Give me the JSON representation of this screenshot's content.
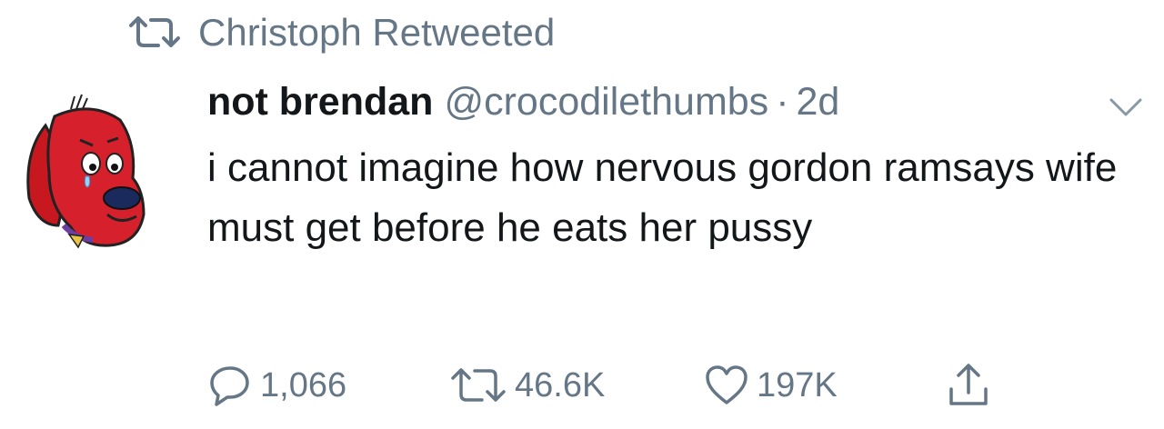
{
  "retweet_banner": {
    "text": "Christoph Retweeted",
    "icon": "retweet-icon"
  },
  "tweet": {
    "display_name": "not brendan",
    "handle": "@crocodilethumbs",
    "separator": "·",
    "time": "2d",
    "text": "i cannot imagine how nervous gordon ramsays wife must get before he eats her pussy",
    "avatar_icon": "red-dog-avatar"
  },
  "actions": {
    "reply_count": "1,066",
    "retweet_count": "46.6K",
    "like_count": "197K",
    "share_icon": "share-icon"
  },
  "colors": {
    "text": "#14171a",
    "muted": "#657786",
    "avatar_red": "#d6202c"
  }
}
